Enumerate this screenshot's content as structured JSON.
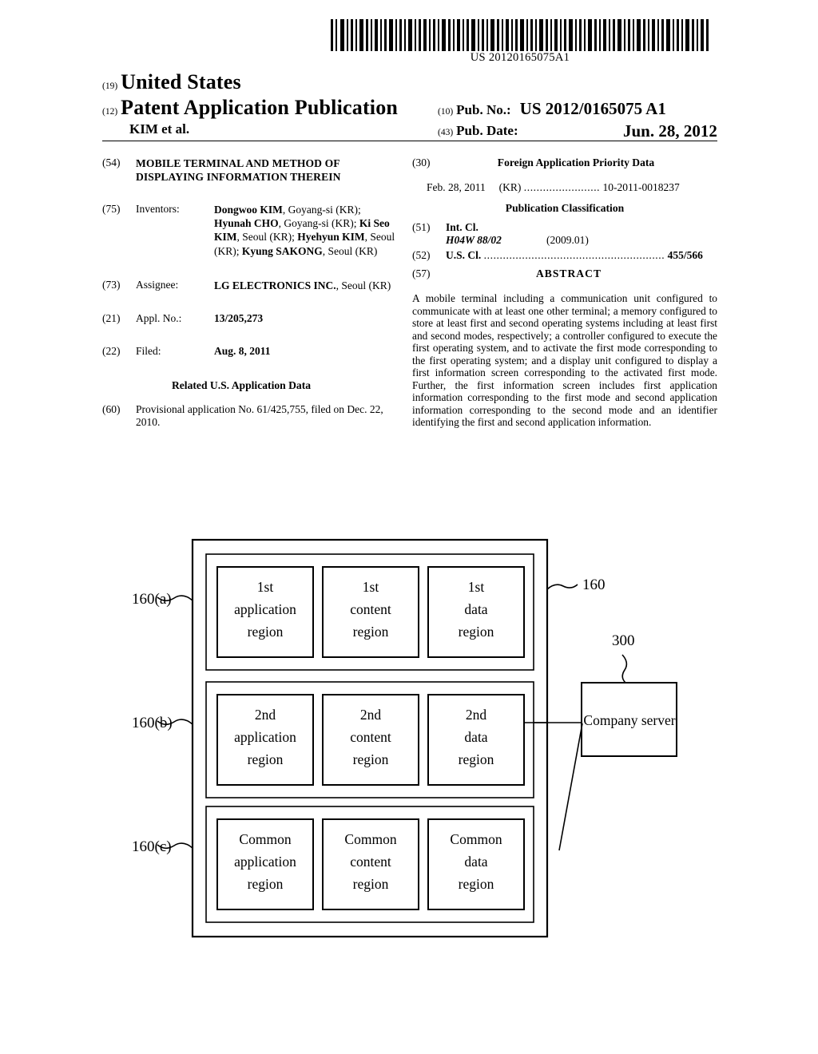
{
  "document": {
    "barcode_caption": "US 20120165075A1",
    "country_inid": "(19)",
    "country": "United States",
    "kind_inid": "(12)",
    "kind": "Patent Application Publication",
    "author_line": "KIM et al.",
    "pubno_inid": "(10)",
    "pubno_label": "Pub. No.:",
    "pubno_value": "US 2012/0165075 A1",
    "pubdate_inid": "(43)",
    "pubdate_label": "Pub. Date:",
    "pubdate_value": "Jun. 28, 2012"
  },
  "left_column": {
    "title": {
      "inid": "(54)",
      "text": "MOBILE TERMINAL AND METHOD OF DISPLAYING INFORMATION THEREIN"
    },
    "inventors": {
      "inid": "(75)",
      "label": "Inventors:",
      "text": "Dongwoo KIM, Goyang-si (KR); Hyunah CHO, Goyang-si (KR); Ki Seo KIM, Seoul (KR); Hyehyun KIM, Seoul (KR); Kyung SAKONG, Seoul (KR)",
      "list": [
        {
          "name": "Dongwoo KIM",
          "city": "Goyang-si (KR)"
        },
        {
          "name": "Hyunah CHO",
          "city": "Goyang-si (KR)"
        },
        {
          "name": "Ki Seo KIM",
          "city": "Seoul (KR)"
        },
        {
          "name": "Hyehyun KIM",
          "city": "Seoul (KR)"
        },
        {
          "name": "Kyung SAKONG",
          "city": "Seoul (KR)"
        }
      ]
    },
    "assignee": {
      "inid": "(73)",
      "label": "Assignee:",
      "name": "LG ELECTRONICS INC.",
      "city": "Seoul (KR)"
    },
    "appl_no": {
      "inid": "(21)",
      "label": "Appl. No.:",
      "value": "13/205,273"
    },
    "filed": {
      "inid": "(22)",
      "label": "Filed:",
      "value": "Aug. 8, 2011"
    },
    "related_heading": "Related U.S. Application Data",
    "provisional": {
      "inid": "(60)",
      "text": "Provisional application No. 61/425,755, filed on Dec. 22, 2010."
    }
  },
  "right_column": {
    "foreign_priority": {
      "inid": "(30)",
      "heading": "Foreign Application Priority Data",
      "date": "Feb. 28, 2011",
      "country": "(KR)",
      "dots": "........................",
      "number": "10-2011-0018237"
    },
    "publication_classification_heading": "Publication Classification",
    "int_cl": {
      "inid": "(51)",
      "label": "Int. Cl.",
      "code": "H04W 88/02",
      "version": "(2009.01)"
    },
    "us_cl": {
      "inid": "(52)",
      "label": "U.S. Cl.",
      "dots": ".........................................................",
      "value": "455/566"
    },
    "abstract": {
      "inid": "(57)",
      "heading": "ABSTRACT",
      "text": "A mobile terminal including a communication unit configured to communicate with at least one other terminal; a memory configured to store at least first and second operating systems including at least first and second modes, respectively; a controller configured to execute the first operating system, and to activate the first mode corresponding to the first operating system; and a display unit configured to display a first information screen corresponding to the activated first mode. Further, the first information screen includes first application information corresponding to the first mode and second application information corresponding to the second mode and an identifier identifying the first and second application information."
    }
  },
  "figure": {
    "outer_ref": "160",
    "server_ref": "300",
    "server_label": "Company server",
    "rows": [
      {
        "ref": "160(a)",
        "boxes": [
          {
            "line1": "1st",
            "line2": "application",
            "line3": "region"
          },
          {
            "line1": "1st",
            "line2": "content",
            "line3": "region"
          },
          {
            "line1": "1st",
            "line2": "data",
            "line3": "region"
          }
        ]
      },
      {
        "ref": "160(b)",
        "boxes": [
          {
            "line1": "2nd",
            "line2": "application",
            "line3": "region"
          },
          {
            "line1": "2nd",
            "line2": "content",
            "line3": "region"
          },
          {
            "line1": "2nd",
            "line2": "data",
            "line3": "region"
          }
        ]
      },
      {
        "ref": "160(c)",
        "boxes": [
          {
            "line1": "Common",
            "line2": "application",
            "line3": "region"
          },
          {
            "line1": "Common",
            "line2": "content",
            "line3": "region"
          },
          {
            "line1": "Common",
            "line2": "data",
            "line3": "region"
          }
        ]
      }
    ]
  }
}
